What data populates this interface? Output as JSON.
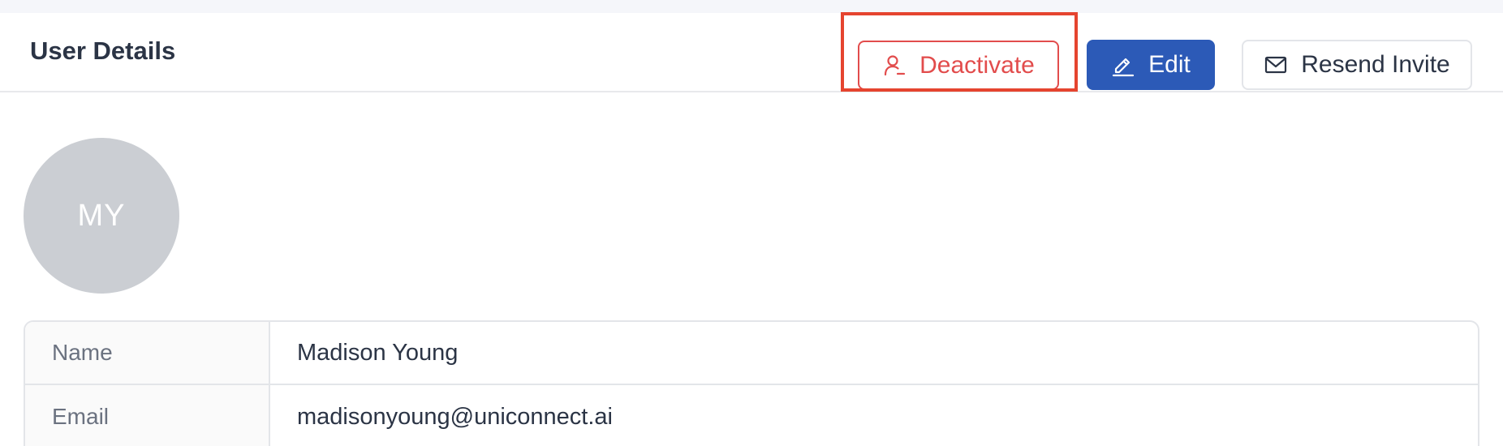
{
  "header": {
    "title": "User Details",
    "buttons": {
      "deactivate": {
        "label": "Deactivate",
        "icon": "user-minus-icon",
        "color": "#e24c4c"
      },
      "edit": {
        "label": "Edit",
        "icon": "pencil-icon",
        "color": "#2c5ab7"
      },
      "resend": {
        "label": "Resend Invite",
        "icon": "mail-icon"
      }
    }
  },
  "highlight": {
    "target": "deactivate-button",
    "color": "#e5442f"
  },
  "profile": {
    "avatar_initials": "MY",
    "fields": [
      {
        "label": "Name",
        "value": "Madison Young"
      },
      {
        "label": "Email",
        "value": "madisonyoung@uniconnect.ai"
      }
    ]
  }
}
